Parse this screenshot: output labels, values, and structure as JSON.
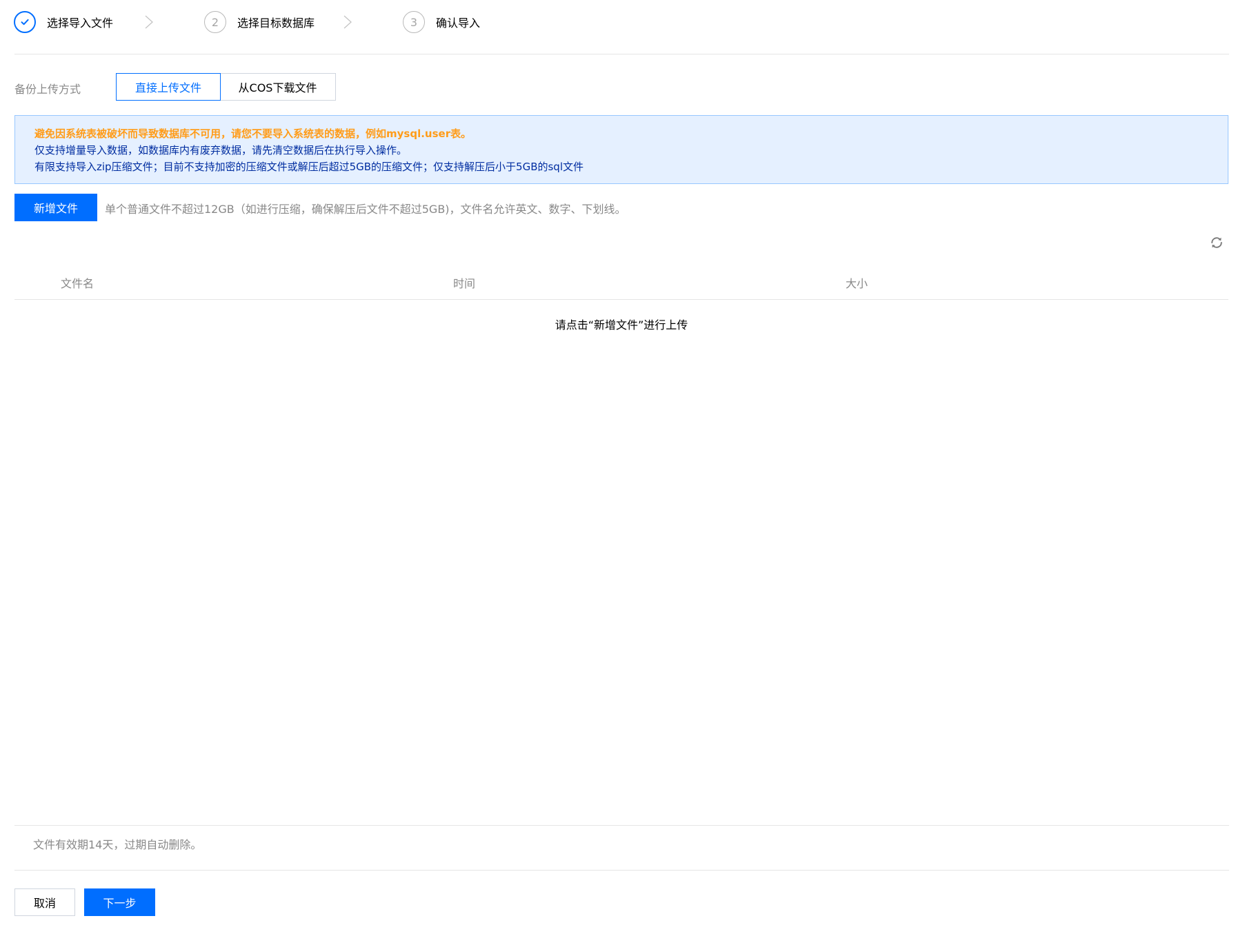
{
  "steps": [
    {
      "number": "",
      "label": "选择导入文件",
      "state": "done"
    },
    {
      "number": "2",
      "label": "选择目标数据库",
      "state": "pending"
    },
    {
      "number": "3",
      "label": "确认导入",
      "state": "pending"
    }
  ],
  "upload_method": {
    "label": "备份上传方式",
    "options": [
      "直接上传文件",
      "从COS下载文件"
    ],
    "selected": "直接上传文件"
  },
  "notice": {
    "warning": "避免因系统表被破坏而导致数据库不可用，请您不要导入系统表的数据，例如mysql.user表。",
    "line2": "仅支持增量导入数据，如数据库内有废弃数据，请先清空数据后在执行导入操作。",
    "line3": "有限支持导入zip压缩文件；目前不支持加密的压缩文件或解压后超过5GB的压缩文件；仅支持解压后小于5GB的sql文件"
  },
  "add_file": {
    "button_label": "新增文件",
    "hint": "单个普通文件不超过12GB（如进行压缩，确保解压后文件不超过5GB)，文件名允许英文、数字、下划线。"
  },
  "table": {
    "columns": [
      "文件名",
      "时间",
      "大小"
    ],
    "rows": [],
    "empty_text": "请点击“新增文件”进行上传"
  },
  "footer": {
    "expire_note": "文件有效期14天，过期自动删除。",
    "cancel_label": "取消",
    "next_label": "下一步"
  },
  "icons": {
    "done_step": "check-icon",
    "step_separator": "chevron-right-icon",
    "refresh": "refresh-icon"
  },
  "colors": {
    "primary": "#006eff",
    "warning": "#ff9c19",
    "notice_bg": "#e5f0ff",
    "notice_text": "#002da0",
    "muted_text": "#888888"
  }
}
